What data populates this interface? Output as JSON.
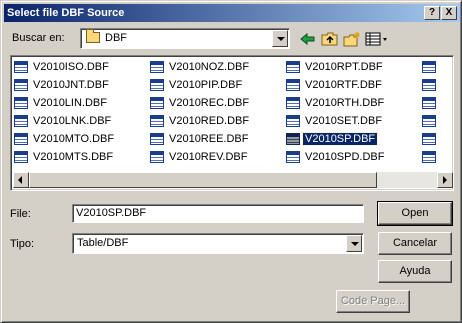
{
  "window": {
    "title": "Select file DBF Source"
  },
  "titlebar_buttons": {
    "help": "?",
    "close": "X"
  },
  "lookin": {
    "label": "Buscar en:",
    "value": "DBF"
  },
  "files": [
    {
      "name": "V2010ISO.DBF"
    },
    {
      "name": "V2010JNT.DBF"
    },
    {
      "name": "V2010LIN.DBF"
    },
    {
      "name": "V2010LNK.DBF"
    },
    {
      "name": "V2010MTO.DBF"
    },
    {
      "name": "V2010MTS.DBF"
    },
    {
      "name": "V2010NOZ.DBF"
    },
    {
      "name": "V2010PIP.DBF"
    },
    {
      "name": "V2010REC.DBF"
    },
    {
      "name": "V2010RED.DBF"
    },
    {
      "name": "V2010REE.DBF"
    },
    {
      "name": "V2010REV.DBF"
    },
    {
      "name": "V2010RPT.DBF"
    },
    {
      "name": "V2010RTF.DBF"
    },
    {
      "name": "V2010RTH.DBF"
    },
    {
      "name": "V2010SET.DBF"
    },
    {
      "name": "V2010SP.DBF",
      "selected": true
    },
    {
      "name": "V2010SPD.DBF"
    }
  ],
  "filename": {
    "label": "File:",
    "value": "V2010SP.DBF"
  },
  "filetype": {
    "label": "Tipo:",
    "value": "Table/DBF"
  },
  "buttons": {
    "open": "Open",
    "cancel": "Cancelar",
    "help": "Ayuda",
    "codepage": "Code Page..."
  },
  "colors": {
    "titlebar_start": "#0a246a",
    "titlebar_end": "#a6caf0",
    "selection": "#0a246a",
    "face": "#d4d0c8"
  }
}
